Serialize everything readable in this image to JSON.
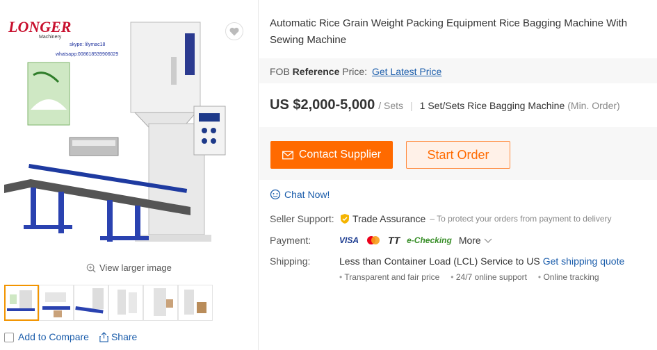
{
  "product": {
    "title": "Automatic Rice Grain Weight Packing Equipment Rice Bagging Machine With Sewing Machine",
    "image": {
      "brand_logo": "LONGER",
      "brand_sub": "Machinery",
      "skype": "skype: lilymac18",
      "whatsapp": "whatsapp:008618539906029"
    },
    "view_larger": "View larger image",
    "thumbnail_count": 6
  },
  "fob": {
    "prefix": "FOB",
    "reference": "Reference",
    "price_label": "Price:",
    "link": "Get Latest Price"
  },
  "pricing": {
    "price": "US $2,000-5,000",
    "unit": "/ Sets",
    "separator": "|",
    "moq": "1 Set/Sets Rice Bagging Machine",
    "moq_hint": "(Min. Order)"
  },
  "actions": {
    "contact": "Contact Supplier",
    "start_order": "Start Order"
  },
  "chat": {
    "label": "Chat Now!"
  },
  "seller_support": {
    "label": "Seller Support:",
    "trade_assurance": "Trade Assurance",
    "hint": "– To protect your orders from payment to delivery"
  },
  "payment": {
    "label": "Payment:",
    "methods": [
      "VISA",
      "TT",
      "e-Checking"
    ],
    "more": "More"
  },
  "shipping": {
    "label": "Shipping:",
    "text": "Less than Container Load (LCL) Service to US",
    "link": "Get shipping quote",
    "bullets": [
      "Transparent and fair price",
      "24/7 online support",
      "Online tracking"
    ]
  },
  "bottom": {
    "compare": "Add to Compare",
    "share": "Share"
  },
  "colors": {
    "accent": "#ff6a00",
    "link": "#1b5dab"
  }
}
